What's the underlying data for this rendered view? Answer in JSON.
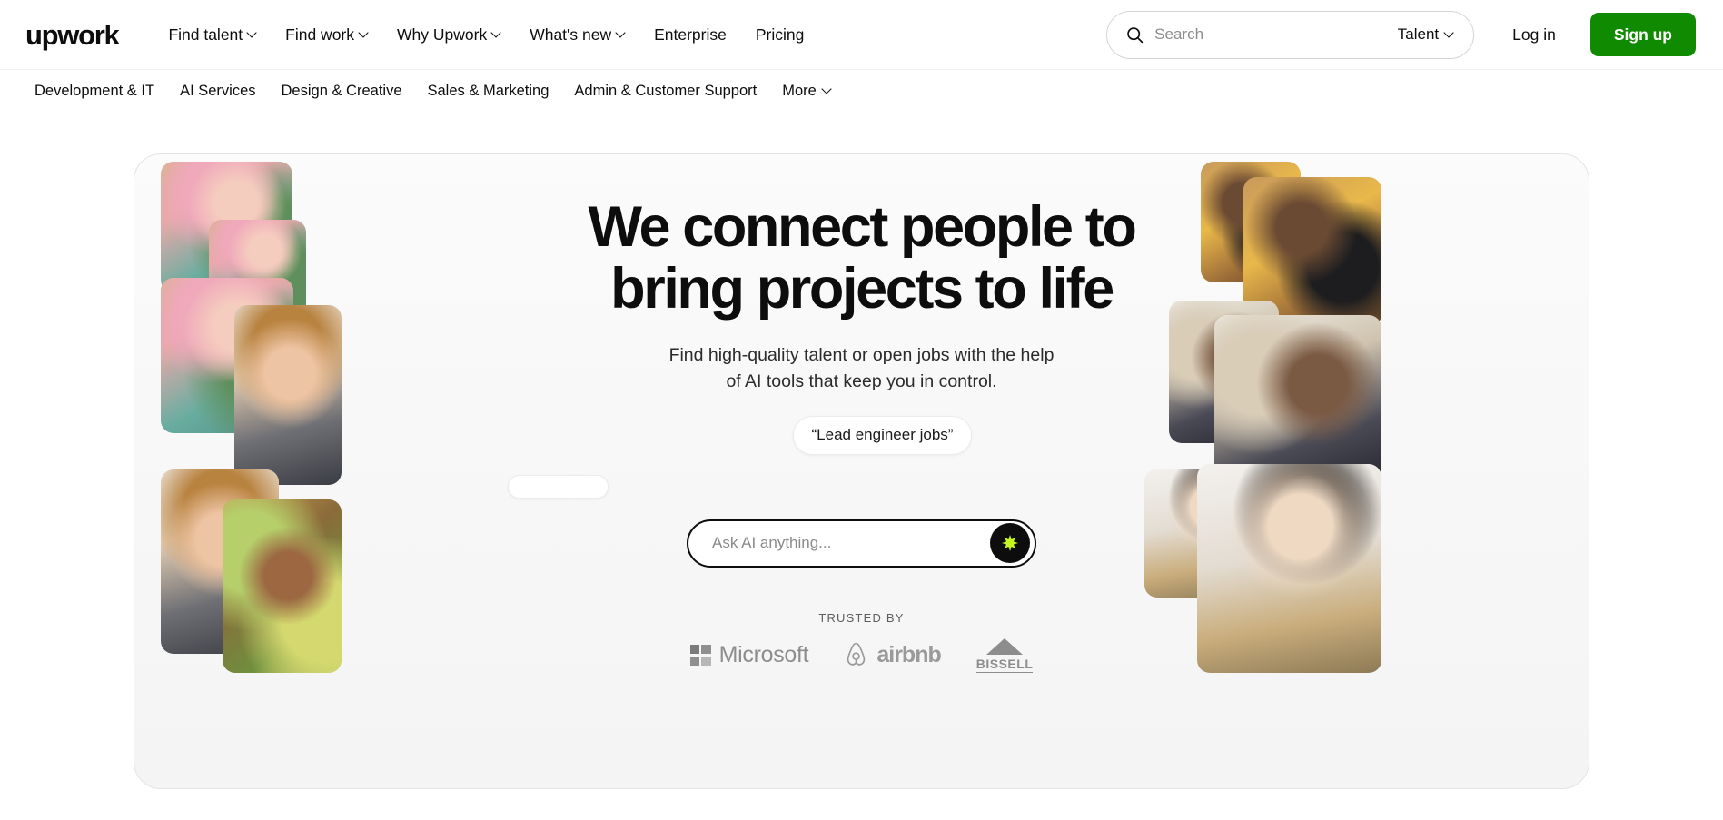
{
  "brand": {
    "logo_text": "upwork",
    "accent_green": "#108a00",
    "ai_accent": "#c6f622"
  },
  "header": {
    "nav": [
      {
        "label": "Find talent",
        "has_caret": true
      },
      {
        "label": "Find work",
        "has_caret": true
      },
      {
        "label": "Why Upwork",
        "has_caret": true
      },
      {
        "label": "What's new",
        "has_caret": true
      },
      {
        "label": "Enterprise",
        "has_caret": false
      },
      {
        "label": "Pricing",
        "has_caret": false
      }
    ],
    "search": {
      "placeholder": "Search",
      "value": "",
      "scope": "Talent"
    },
    "login_label": "Log in",
    "signup_label": "Sign up"
  },
  "categories": [
    {
      "label": "Development & IT",
      "has_caret": false
    },
    {
      "label": "AI Services",
      "has_caret": false
    },
    {
      "label": "Design & Creative",
      "has_caret": false
    },
    {
      "label": "Sales & Marketing",
      "has_caret": false
    },
    {
      "label": "Admin & Customer Support",
      "has_caret": false
    },
    {
      "label": "More",
      "has_caret": true
    }
  ],
  "hero": {
    "headline": "We connect people to bring projects to life",
    "subheadline": "Find high-quality talent or open jobs with the help of AI tools that keep you in control.",
    "suggestion_chip": "“Lead engineer jobs”",
    "ask": {
      "placeholder": "Ask AI anything...",
      "value": ""
    }
  },
  "trusted": {
    "label": "TRUSTED BY",
    "logos": [
      {
        "name": "Microsoft",
        "word": "Microsoft"
      },
      {
        "name": "airbnb",
        "word": "airbnb"
      },
      {
        "name": "BISSELL",
        "word": "BISSELL"
      }
    ]
  }
}
